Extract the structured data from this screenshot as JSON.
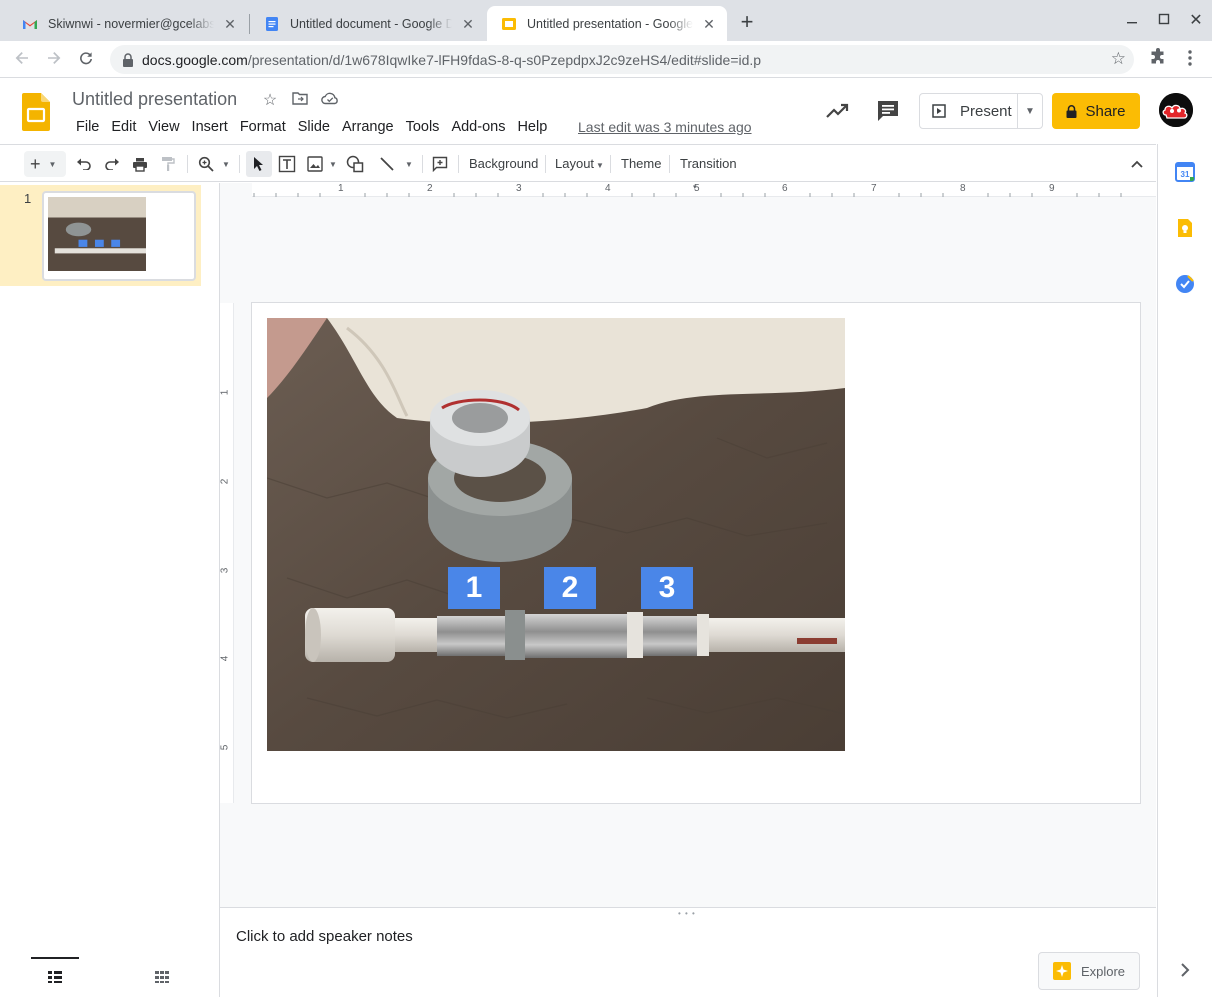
{
  "browser": {
    "tabs": [
      {
        "title": "Skiwnwi - novermier@gcelabsch",
        "icon": "gmail-icon"
      },
      {
        "title": "Untitled document - Google Drive",
        "icon": "docs-icon"
      },
      {
        "title": "Untitled presentation - Google Slides",
        "icon": "slides-icon",
        "active": true
      }
    ],
    "url_host": "docs.google.com",
    "url_path": "/presentation/d/1w678IqwIke7-lFH9fdaS-8-q-s0PzepdpxJ2c9zeHS4/edit#slide=id.p"
  },
  "app": {
    "doc_title": "Untitled presentation",
    "menu": [
      "File",
      "Edit",
      "View",
      "Insert",
      "Format",
      "Slide",
      "Arrange",
      "Tools",
      "Add-ons",
      "Help"
    ],
    "last_edit": "Last edit was 3 minutes ago",
    "present_label": "Present",
    "share_label": "Share",
    "accent_share": "#fbbc04"
  },
  "toolbar": {
    "background_label": "Background",
    "layout_label": "Layout",
    "theme_label": "Theme",
    "transition_label": "Transition"
  },
  "ruler": {
    "h_labels": [
      "1",
      "2",
      "3",
      "4",
      "5",
      "6",
      "7",
      "8",
      "9"
    ],
    "v_labels": [
      "1",
      "2",
      "3",
      "4",
      "5"
    ]
  },
  "filmstrip": {
    "slides": [
      {
        "number": "1"
      }
    ]
  },
  "slide": {
    "number_boxes": [
      "1",
      "2",
      "3"
    ],
    "box_color": "#4a86e8"
  },
  "notes": {
    "placeholder": "Click to add speaker notes"
  },
  "explore": {
    "label": "Explore"
  }
}
